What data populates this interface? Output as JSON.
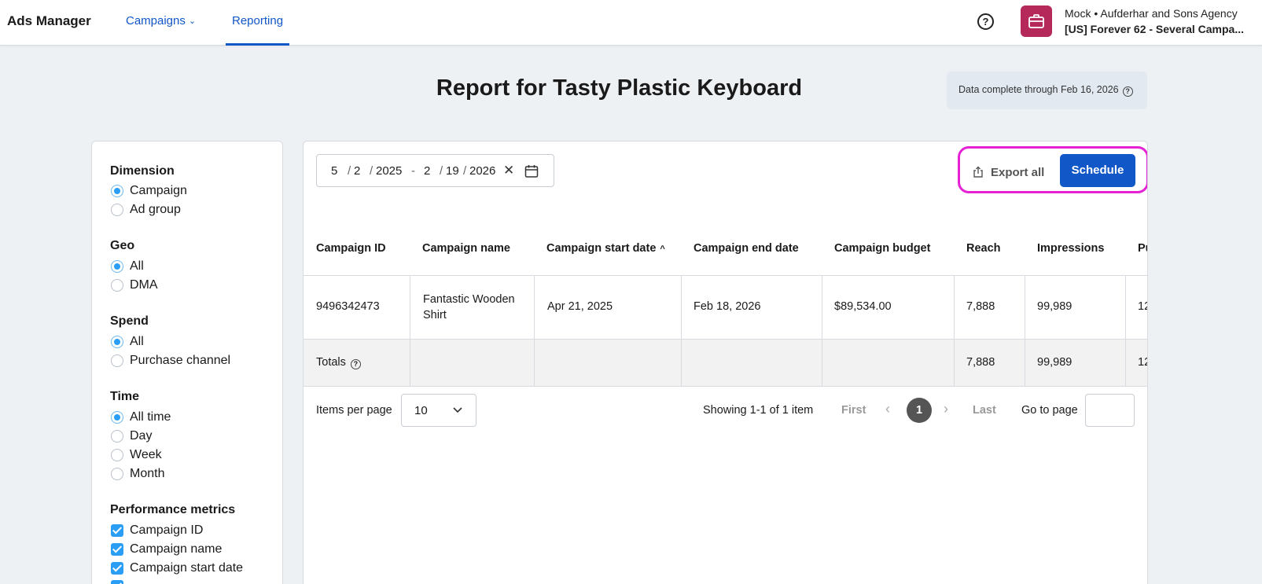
{
  "nav": {
    "brand": "Ads Manager",
    "campaigns": "Campaigns",
    "reporting": "Reporting"
  },
  "account": {
    "line1": "Mock • Aufderhar and Sons Agency",
    "line2": "[US] Forever 62 - Several Campa..."
  },
  "page": {
    "title": "Report for Tasty Plastic Keyboard",
    "data_complete": "Data complete through Feb 16, 2026"
  },
  "sidebar": {
    "dimension": {
      "title": "Dimension",
      "options": [
        "Campaign",
        "Ad group"
      ],
      "selected": "Campaign"
    },
    "geo": {
      "title": "Geo",
      "options": [
        "All",
        "DMA"
      ],
      "selected": "All"
    },
    "spend": {
      "title": "Spend",
      "options": [
        "All",
        "Purchase channel"
      ],
      "selected": "All"
    },
    "time": {
      "title": "Time",
      "options": [
        "All time",
        "Day",
        "Week",
        "Month"
      ],
      "selected": "All time"
    },
    "metrics": {
      "title": "Performance metrics",
      "checked": [
        "Campaign ID",
        "Campaign name",
        "Campaign start date"
      ]
    }
  },
  "date_range": {
    "start_month": "5",
    "start_day": "2",
    "start_year": "2025",
    "end_month": "2",
    "end_day": "19",
    "end_year": "2026",
    "slash": "/",
    "dash": "-"
  },
  "actions": {
    "export": "Export all",
    "schedule": "Schedule"
  },
  "table": {
    "headers": [
      "Campaign ID",
      "Campaign name",
      "Campaign start date",
      "Campaign end date",
      "Campaign budget",
      "Reach",
      "Impressions",
      "Pu"
    ],
    "sort_indicator": "^",
    "row": {
      "campaign_id": "9496342473",
      "campaign_name": "Fantastic Wooden Shirt",
      "start_date": "Apr 21, 2025",
      "end_date": "Feb 18, 2026",
      "budget": "$89,534.00",
      "reach": "7,888",
      "impressions": "99,989",
      "cut": "12"
    },
    "totals": {
      "label": "Totals",
      "reach": "7,888",
      "impressions": "99,989",
      "cut": "12"
    }
  },
  "pagination": {
    "items_per_page_label": "Items per page",
    "items_per_page": "10",
    "showing": "Showing 1-1 of 1 item",
    "first": "First",
    "current": "1",
    "last": "Last",
    "goto_label": "Go to page"
  },
  "colors": {
    "primary": "#1157c7",
    "highlight": "#e621d6",
    "avatar": "#b5285a",
    "radio_checked": "#2a9df4"
  }
}
